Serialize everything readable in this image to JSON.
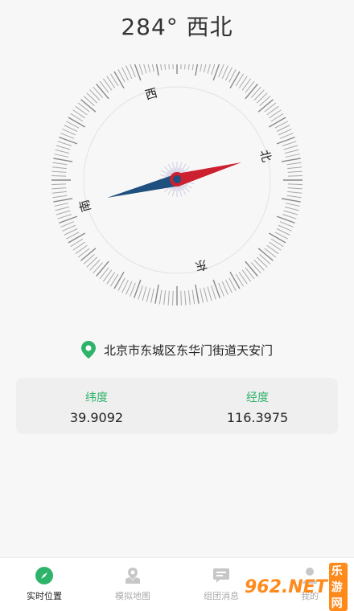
{
  "heading": {
    "degree": "284°",
    "direction": "西北"
  },
  "compass": {
    "labels": {
      "north": "北",
      "south": "南",
      "east": "东",
      "west": "西"
    },
    "accent_red": "#cc1f2f",
    "accent_blue": "#1f4f7f"
  },
  "location": {
    "address": "北京市东城区东华门街道天安门",
    "pin_color": "#2fb36a"
  },
  "coords": {
    "latitude_label": "纬度",
    "latitude_value": "39.9092",
    "longitude_label": "经度",
    "longitude_value": "116.3975"
  },
  "nav": {
    "items": [
      {
        "label": "实时位置",
        "icon": "compass-icon",
        "active": true
      },
      {
        "label": "模拟地图",
        "icon": "map-pin-icon",
        "active": false
      },
      {
        "label": "组团消息",
        "icon": "chat-icon",
        "active": false
      },
      {
        "label": "我的",
        "icon": "user-icon",
        "active": false
      }
    ]
  },
  "watermark": {
    "text": "962.NET",
    "sub": "乐游网"
  }
}
